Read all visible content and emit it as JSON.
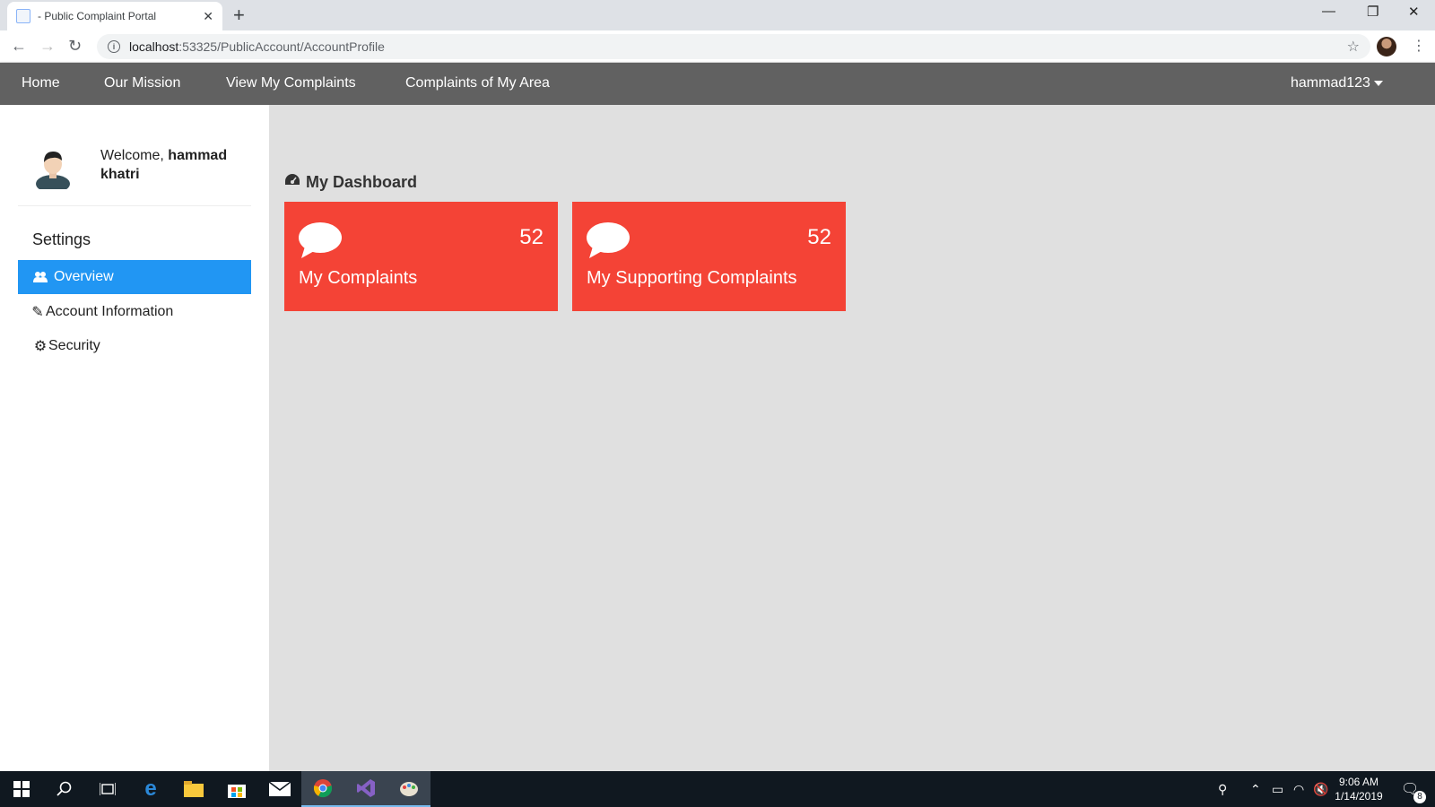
{
  "browser": {
    "tab_title": "- Public Complaint Portal",
    "url_host": "localhost",
    "url_rest": ":53325/PublicAccount/AccountProfile"
  },
  "nav": {
    "home": "Home",
    "mission": "Our Mission",
    "my_complaints": "View My Complaints",
    "area_complaints": "Complaints of My Area",
    "user": "hammad123"
  },
  "sidebar": {
    "welcome_prefix": "Welcome,",
    "user_name": "hammad khatri",
    "settings_title": "Settings",
    "items": [
      {
        "label": "Overview",
        "icon": "users-icon",
        "active": true
      },
      {
        "label": "Account Information",
        "icon": "pencil-icon",
        "active": false
      },
      {
        "label": "Security",
        "icon": "gear-icon",
        "active": false
      }
    ]
  },
  "dashboard": {
    "title": "My Dashboard",
    "cards": [
      {
        "label": "My Complaints",
        "count": "52",
        "icon": "comment-icon"
      },
      {
        "label": "My Supporting Complaints",
        "count": "52",
        "icon": "comment-icon"
      }
    ]
  },
  "taskbar": {
    "time": "9:06 AM",
    "date": "1/14/2019",
    "notifications": "8"
  },
  "colors": {
    "nav_bg": "#616161",
    "active_item": "#2196f3",
    "card_bg": "#f44336",
    "content_bg": "#e0e0e0"
  }
}
